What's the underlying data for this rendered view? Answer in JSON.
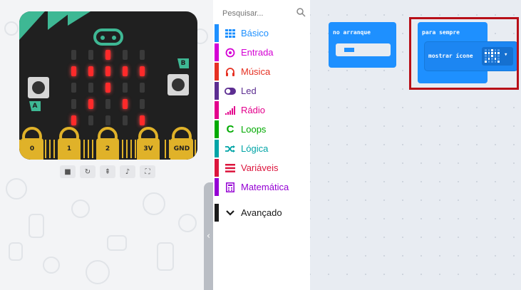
{
  "toolbox": {
    "search_placeholder": "Pesquisar...",
    "categories": [
      {
        "label": "Básico",
        "color": "#1e90ff",
        "icon": "grid-icon"
      },
      {
        "label": "Entrada",
        "color": "#d400d4",
        "icon": "circle-dot-icon"
      },
      {
        "label": "Música",
        "color": "#e63022",
        "icon": "headphones-icon"
      },
      {
        "label": "Led",
        "color": "#5c2d91",
        "icon": "toggle-icon"
      },
      {
        "label": "Rádio",
        "color": "#e3008c",
        "icon": "signal-icon"
      },
      {
        "label": "Loops",
        "color": "#00aa00",
        "icon": "loop-icon"
      },
      {
        "label": "Lógica",
        "color": "#00a4a6",
        "icon": "shuffle-icon"
      },
      {
        "label": "Variáveis",
        "color": "#dc143c",
        "icon": "lines-icon"
      },
      {
        "label": "Matemática",
        "color": "#9400d3",
        "icon": "calculator-icon"
      },
      {
        "label": "Avançado",
        "color": "#1a1a1a",
        "icon": "chevron-down-icon"
      }
    ]
  },
  "simulator": {
    "pins": [
      "0",
      "1",
      "2",
      "3V",
      "GND"
    ],
    "button_a": "A",
    "button_b": "B",
    "accent": "#3eb894",
    "led_color": "#ff2a2a",
    "led_matrix": [
      [
        0,
        0,
        1,
        0,
        0
      ],
      [
        1,
        1,
        1,
        1,
        1
      ],
      [
        0,
        0,
        1,
        0,
        0
      ],
      [
        0,
        1,
        0,
        1,
        0
      ],
      [
        1,
        0,
        0,
        0,
        1
      ]
    ]
  },
  "workspace": {
    "on_start_label": "no arranque",
    "forever_label": "para sempre",
    "show_icon_label": "mostrar ícone",
    "block_color": "#1e90ff",
    "highlight_color": "#b80f18"
  }
}
